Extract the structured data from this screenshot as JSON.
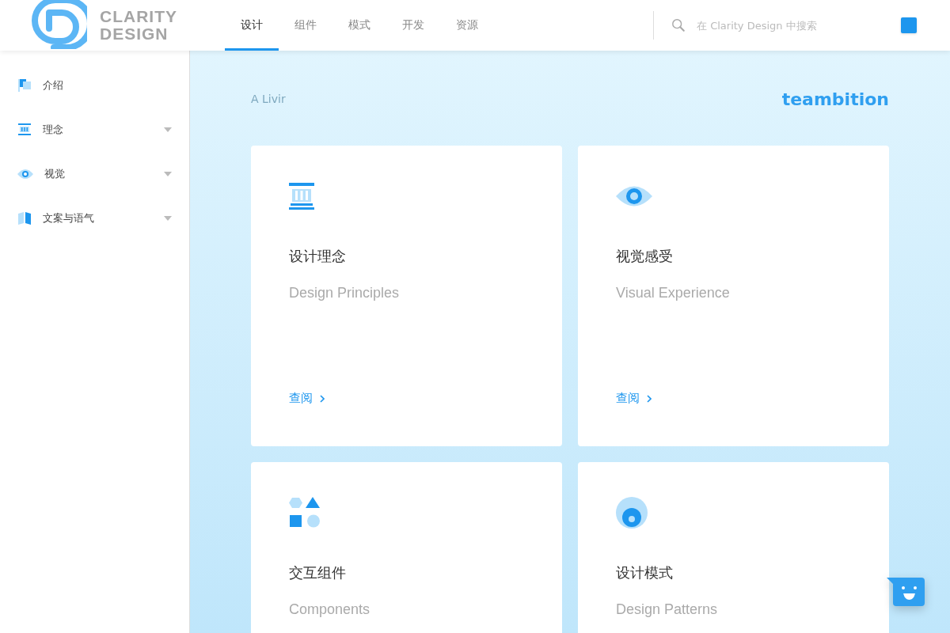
{
  "logo": {
    "line_1": "CLARITY",
    "line_2": "DESIGN"
  },
  "nav_tabs": [
    {
      "label": "设计",
      "selected": true
    },
    {
      "label": "组件",
      "selected": false
    },
    {
      "label": "模式",
      "selected": false
    },
    {
      "label": "开发",
      "selected": false
    },
    {
      "label": "资源",
      "selected": false
    }
  ],
  "search": {
    "placeholder": "在 Clarity Design 中搜索"
  },
  "sidebar": {
    "items": [
      {
        "label": "介绍",
        "kind": "flag",
        "expandable": false
      },
      {
        "label": "理念",
        "kind": "pillar",
        "expandable": true
      },
      {
        "label": "视觉",
        "kind": "eye",
        "expandable": true
      },
      {
        "label": "文案与语气",
        "kind": "book",
        "expandable": true
      }
    ]
  },
  "banner": {
    "faint_text": "A Livir",
    "brand": "teambition"
  },
  "cards": [
    {
      "kind": "pillar",
      "title": "设计理念",
      "subtitle": "Design Principles",
      "link": "查阅"
    },
    {
      "kind": "eye",
      "title": "视觉感受",
      "subtitle": "Visual Experience",
      "link": "查阅"
    },
    {
      "kind": "shapes",
      "title": "交互组件",
      "subtitle": "Components"
    },
    {
      "kind": "target",
      "title": "设计模式",
      "subtitle": "Design Patterns"
    }
  ]
}
